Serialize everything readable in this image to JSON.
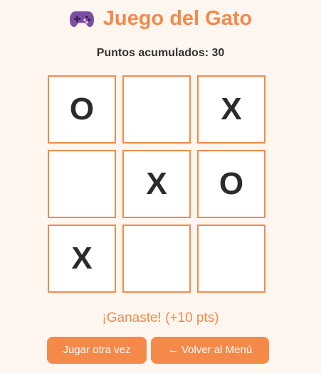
{
  "header": {
    "title": "Juego del Gato",
    "icon": "gamepad-icon",
    "icon_color": "#7b4ea3"
  },
  "score": {
    "text": "Puntos acumulados: 30"
  },
  "board": {
    "cells": [
      "O",
      "",
      "X",
      "",
      "X",
      "O",
      "X",
      "",
      ""
    ]
  },
  "status": {
    "text": "¡Ganaste! (+10 pts)"
  },
  "buttons": {
    "replay_label": "Jugar otra vez",
    "back_label": "← Volver al Menú"
  },
  "colors": {
    "accent": "#f5894a",
    "background": "#fff6ef",
    "mark": "#2b2b2b"
  }
}
